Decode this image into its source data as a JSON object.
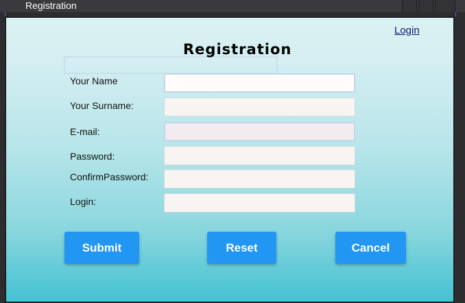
{
  "window": {
    "title": "Registration"
  },
  "header": {
    "login_link": "Login",
    "heading": "Registration"
  },
  "form": {
    "fields": [
      {
        "label": "Your Name",
        "value": ""
      },
      {
        "label": "Your Surname:",
        "value": ""
      },
      {
        "label": "E-mail:",
        "value": ""
      },
      {
        "label": "Password:",
        "value": ""
      },
      {
        "label": "ConfirmPassword:",
        "value": ""
      },
      {
        "label": "Login:",
        "value": ""
      }
    ]
  },
  "buttons": {
    "submit": "Submit",
    "reset": "Reset",
    "cancel": "Cancel"
  },
  "colors": {
    "accent": "#2196f3",
    "link": "#0c1a70"
  }
}
